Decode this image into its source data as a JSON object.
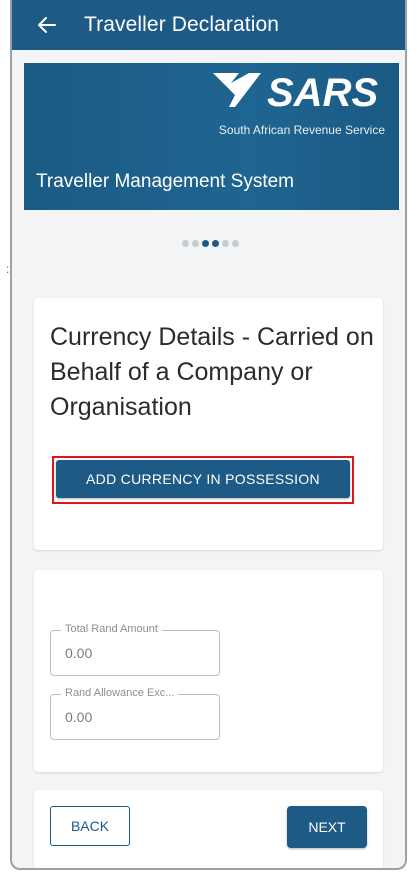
{
  "appbar": {
    "title": "Traveller Declaration",
    "back_icon": "arrow-left-icon"
  },
  "banner": {
    "logo_text": "SARS",
    "subtitle": "South African Revenue Service",
    "system_title": "Traveller Management System"
  },
  "stepper": {
    "total_steps": 6,
    "active_step": 3
  },
  "currency_card": {
    "heading": "Currency Details - Carried on Behalf of a Company or Organisation",
    "add_button_label": "ADD CURRENCY IN POSSESSION"
  },
  "amounts_card": {
    "fields": [
      {
        "label": "Total Rand Amount",
        "value": "0.00"
      },
      {
        "label": "Rand Allowance Exc...",
        "value": "0.00"
      }
    ]
  },
  "nav": {
    "back_label": "BACK",
    "next_label": "NEXT"
  },
  "colors": {
    "primary": "#1d5a86",
    "highlight": "#e0151b",
    "background": "#f3f4f6"
  }
}
